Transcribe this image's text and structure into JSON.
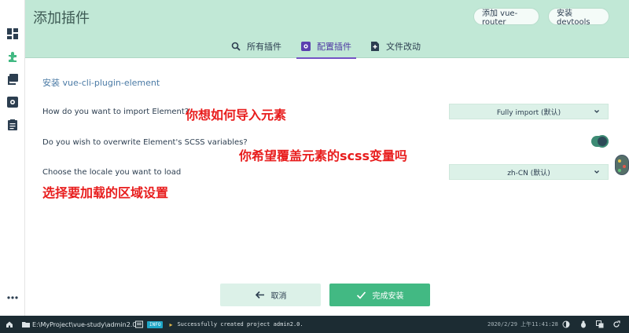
{
  "header": {
    "title": "添加插件",
    "buttons": [
      "添加 vue-router",
      "安装 devtools"
    ]
  },
  "tabs": [
    {
      "label": "所有插件",
      "icon": "search-icon"
    },
    {
      "label": "配置插件",
      "icon": "settings-icon",
      "active": true
    },
    {
      "label": "文件改动",
      "icon": "file-diff-icon"
    }
  ],
  "main": {
    "section_title": "安装 vue-cli-plugin-element",
    "questions": [
      {
        "label": "How do you want to import Element?",
        "annotation": "你想如何导入元素",
        "control": "select",
        "value": "Fully import (默认)"
      },
      {
        "label": "Do you wish to overwrite Element's SCSS variables?",
        "annotation": "你希望覆盖元素的scss变量吗",
        "control": "toggle",
        "on": true
      },
      {
        "label": "Choose the locale you want to load",
        "annotation": "选择要加载的区域设置",
        "control": "select",
        "value": "zh-CN (默认)"
      }
    ]
  },
  "actions": {
    "cancel": "取消",
    "done": "完成安装"
  },
  "statusbar": {
    "path": "E:\\MyProject\\vue-study\\admin2.0",
    "log_level": "INFO",
    "message": "Successfully created project admin2.0.",
    "datetime": "2020/2/29 上午11:41:28"
  },
  "sidebar": {
    "icons": [
      "dashboard-icon",
      "plugin-icon",
      "dependencies-icon",
      "configuration-icon",
      "tasks-icon",
      "more-icon"
    ]
  },
  "colors": {
    "header_bg": "#c1e8d6",
    "accent_green": "#42b983",
    "active_tab": "#7453c4",
    "annotation_red": "#e81d1d",
    "statusbar_bg": "#1c2c33"
  }
}
